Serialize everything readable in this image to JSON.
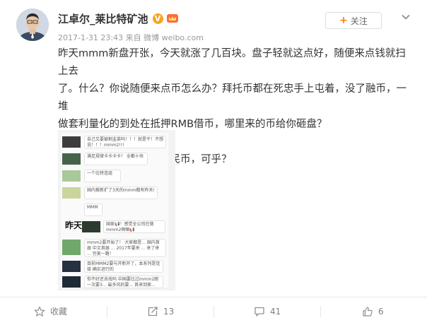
{
  "author": {
    "name": "江卓尔_莱比特矿池",
    "verified_badge": "V",
    "colors": {
      "verified": "#f5a623",
      "follow_accent": "#ff8200"
    }
  },
  "meta": {
    "timestamp": "2017-1-31 23:43",
    "source_prefix": "来自",
    "source": "微博 weibo.com"
  },
  "follow_button": {
    "plus": "+",
    "label": "关注"
  },
  "icons": [
    "chevron-down-icon",
    "crown-icon",
    "favorite-icon",
    "repost-icon",
    "comment-icon",
    "like-icon"
  ],
  "post": {
    "lines": [
      "昨天mmm新盘开张，今天就涨了几百块。盘子轻就这点好，随便来点钱就扫上去",
      "了。什么？你说随便来点币怎么办？拜托币都在死忠手上屯着，没了融币，一堆",
      "做套利量化的到处在抵押RMB借币，哪里来的币给你砸盘？"
    ],
    "second_paragraph": "用有限的BTC砸无限的人民币，可乎？"
  },
  "embedded_image": {
    "side_label": "昨天",
    "messages": [
      "自己又要被割韭菜吗！！！就是干！不想说！！！mmm2!!!",
      "满足规律卡卡卡卡！ 全都十块",
      "一个比特连组",
      "国内推新扩了3天的mmm都有昨天!",
      "MMM",
      "国家📢！感觉全公司在做mmm2啊嘛📢",
      "mmm2要开始了！ 大家都是... 国内首届 中文首届 ... 2017年要来 ... 来了来 ... 完美一路！",
      "目前MMM2要与开新开了，本系列是连接 确实进行的",
      "你不好还去找吗 中国要比过mmm2跑一次要3... 最多风的要... 首来到家... 好我们..."
    ]
  },
  "actions": {
    "favorite": "收藏",
    "repost": "13",
    "comment": "41",
    "like": "6"
  }
}
